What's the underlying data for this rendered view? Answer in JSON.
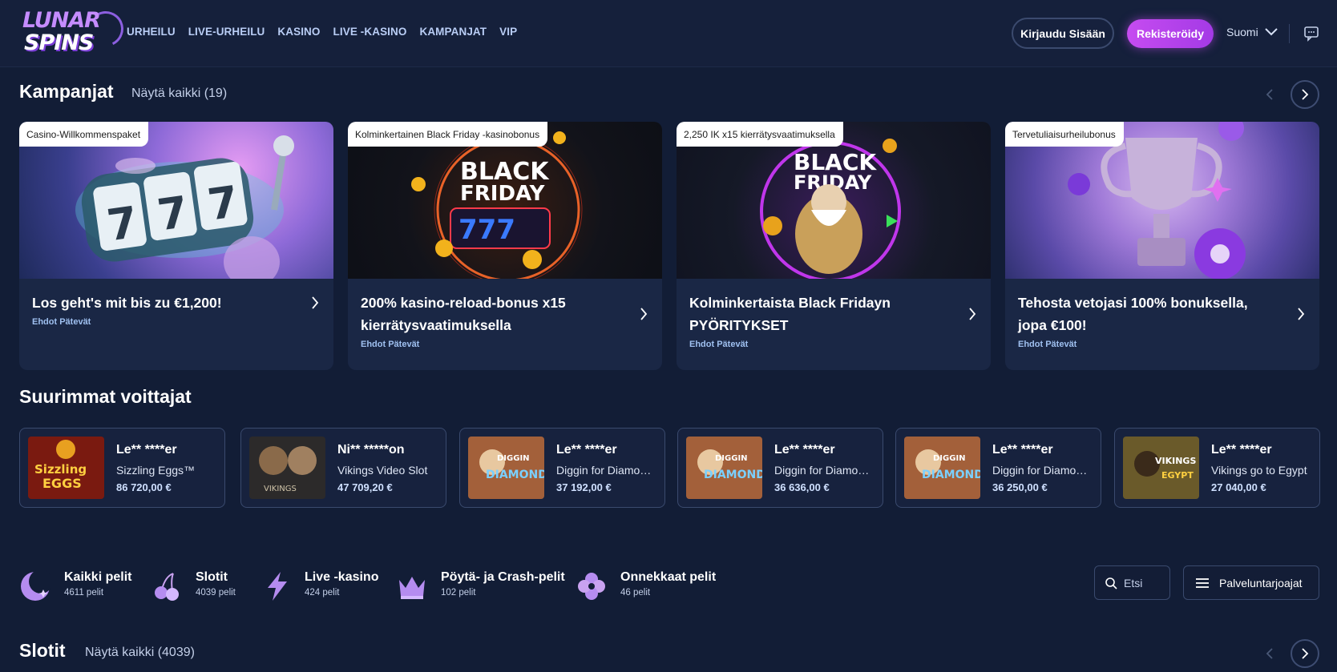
{
  "header": {
    "logo_top": "LUNAR",
    "logo_bottom": "SPINS",
    "nav": [
      "URHEILU",
      "LIVE-URHEILU",
      "KASINO",
      "LIVE -KASINO",
      "KAMPANJAT",
      "VIP"
    ],
    "login_label": "Kirjaudu Sisään",
    "register_label": "Rekisteröidy",
    "language": "Suomi",
    "icons": {
      "language_dropdown": "chevron-down-icon",
      "chat": "chat-icon"
    }
  },
  "campaigns": {
    "title": "Kampanjat",
    "see_all": "Näytä kaikki (19)",
    "cards": [
      {
        "tag": "Casino-Willkommenspaket",
        "title": "Los geht's mit bis zu €1,200!",
        "terms": "Ehdot Pätevät"
      },
      {
        "tag": "Kolminkertainen Black Friday -kasinobonus",
        "title": "200% kasino-reload-bonus x15 kierrätysvaatimuksella",
        "terms": "Ehdot Pätevät",
        "art_text": [
          "BLACK",
          "FRIDAY",
          "777"
        ]
      },
      {
        "tag": "2,250 IK x15 kierrätysvaatimuksella",
        "title": "Kolminkertaista Black Fridayn PYÖRITYKSET",
        "terms": "Ehdot Pätevät",
        "art_text": [
          "BLACK",
          "FRIDAY"
        ]
      },
      {
        "tag": "Tervetuliaisurheilubonus",
        "title": "Tehosta vetojasi 100% bonuksella, jopa €100!",
        "terms": "Ehdot Pätevät"
      }
    ]
  },
  "winners": {
    "title": "Suurimmat voittajat",
    "items": [
      {
        "name": "Le** ****er",
        "game": "Sizzling Eggs™",
        "amount": "86 720,00 €",
        "thumb_text": [
          "Sizzling",
          "EGGS"
        ],
        "thumb_color": "#7a1a10"
      },
      {
        "name": "Ni** *****on",
        "game": "Vikings Video Slot",
        "amount": "47 709,20 €",
        "thumb_text": [
          "VIKINGS"
        ],
        "thumb_color": "#2c2a2a"
      },
      {
        "name": "Le** ****er",
        "game": "Diggin for Diamonds",
        "amount": "37 192,00 €",
        "thumb_text": [
          "DIGGIN",
          "DIAMONDS"
        ],
        "thumb_color": "#a3603a"
      },
      {
        "name": "Le** ****er",
        "game": "Diggin for Diamonds",
        "amount": "36 636,00 €",
        "thumb_text": [
          "DIGGIN",
          "DIAMONDS"
        ],
        "thumb_color": "#a3603a"
      },
      {
        "name": "Le** ****er",
        "game": "Diggin for Diamonds",
        "amount": "36 250,00 €",
        "thumb_text": [
          "DIGGIN",
          "DIAMONDS"
        ],
        "thumb_color": "#a3603a"
      },
      {
        "name": "Le** ****er",
        "game": "Vikings go to Egypt",
        "amount": "27 040,00 €",
        "thumb_text": [
          "VIKINGS",
          "EGYPT"
        ],
        "thumb_color": "#6a5a2a"
      }
    ]
  },
  "categories": [
    {
      "name": "Kaikki pelit",
      "count": "4611 pelit",
      "icon": "moon-icon"
    },
    {
      "name": "Slotit",
      "count": "4039 pelit",
      "icon": "cherries-icon"
    },
    {
      "name": "Live -kasino",
      "count": "424 pelit",
      "icon": "lightning-icon"
    },
    {
      "name": "Pöytä- ja Crash-pelit",
      "count": "102 pelit",
      "icon": "crown-icon"
    },
    {
      "name": "Onnekkaat pelit",
      "count": "46 pelit",
      "icon": "clover-icon"
    }
  ],
  "search": {
    "placeholder": "Etsi"
  },
  "providers_label": "Palveluntarjoajat",
  "slots": {
    "title": "Slotit",
    "see_all": "Näytä kaikki (4039)"
  },
  "colors": {
    "background": "#121d36",
    "card": "#1a2745",
    "accent": "#c64cf0",
    "link": "#9fc0f0"
  }
}
